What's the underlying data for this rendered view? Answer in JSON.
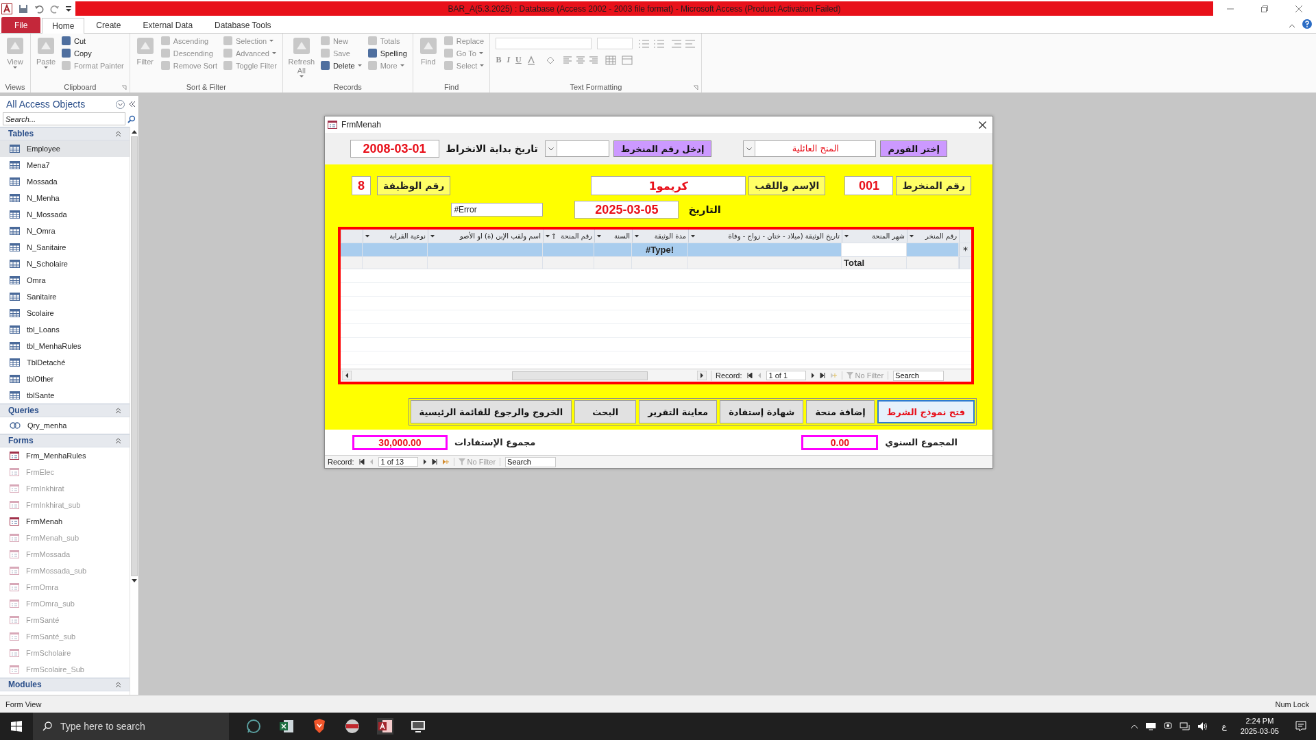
{
  "window": {
    "title": "BAR_A(5.3.2025) : Database (Access 2002 - 2003 file format) - Microsoft Access (Product Activation Failed)"
  },
  "ribbon_tabs": [
    {
      "label": "File",
      "kind": "file",
      "selected": false
    },
    {
      "label": "Home",
      "kind": "tab",
      "selected": true
    },
    {
      "label": "Create",
      "kind": "tab",
      "selected": false
    },
    {
      "label": "External Data",
      "kind": "tab",
      "selected": false
    },
    {
      "label": "Database Tools",
      "kind": "tab",
      "selected": false
    }
  ],
  "ribbon_groups": [
    {
      "label": "Views",
      "items": [
        {
          "label": "View",
          "kind": "large",
          "disabled": true,
          "dropdown": true
        }
      ]
    },
    {
      "label": "Clipboard",
      "launcher": true,
      "items": [
        {
          "label": "Paste",
          "kind": "large",
          "disabled": true,
          "dropdown": true
        },
        {
          "label": "Cut",
          "kind": "small",
          "disabled": false,
          "dropdown": false
        },
        {
          "label": "Copy",
          "kind": "small",
          "disabled": false,
          "dropdown": false
        },
        {
          "label": "Format Painter",
          "kind": "small",
          "disabled": true,
          "dropdown": false
        }
      ]
    },
    {
      "label": "Sort & Filter",
      "launcher": false,
      "items": [
        {
          "label": "Filter",
          "kind": "large",
          "disabled": true,
          "dropdown": false
        },
        {
          "label": "Ascending",
          "kind": "small",
          "disabled": true,
          "dropdown": false
        },
        {
          "label": "Descending",
          "kind": "small",
          "disabled": true,
          "dropdown": false
        },
        {
          "label": "Remove Sort",
          "kind": "small",
          "disabled": true,
          "dropdown": false
        },
        {
          "label": "Selection",
          "kind": "small",
          "disabled": true,
          "dropdown": true
        },
        {
          "label": "Advanced",
          "kind": "small",
          "disabled": true,
          "dropdown": true
        },
        {
          "label": "Toggle Filter",
          "kind": "small",
          "disabled": true,
          "dropdown": false
        }
      ]
    },
    {
      "label": "Records",
      "launcher": false,
      "items": [
        {
          "label": "Refresh All",
          "kind": "large",
          "disabled": true,
          "dropdown": true
        },
        {
          "label": "New",
          "kind": "small",
          "disabled": true,
          "dropdown": false
        },
        {
          "label": "Save",
          "kind": "small",
          "disabled": true,
          "dropdown": false
        },
        {
          "label": "Delete",
          "kind": "small",
          "disabled": false,
          "dropdown": true
        },
        {
          "label": "Totals",
          "kind": "small",
          "disabled": true,
          "dropdown": false
        },
        {
          "label": "Spelling",
          "kind": "small",
          "disabled": false,
          "dropdown": false
        },
        {
          "label": "More",
          "kind": "small",
          "disabled": true,
          "dropdown": true
        }
      ]
    },
    {
      "label": "Find",
      "launcher": false,
      "items": [
        {
          "label": "Find",
          "kind": "large",
          "disabled": true,
          "dropdown": false
        },
        {
          "label": "Replace",
          "kind": "small",
          "disabled": true,
          "dropdown": false
        },
        {
          "label": "Go To",
          "kind": "small",
          "disabled": true,
          "dropdown": true
        },
        {
          "label": "Select",
          "kind": "small",
          "disabled": true,
          "dropdown": true
        }
      ]
    },
    {
      "label": "Text Formatting",
      "launcher": true,
      "items": [
        {
          "label": "B",
          "kind": "format",
          "disabled": true
        },
        {
          "label": "I",
          "kind": "format",
          "disabled": true
        },
        {
          "label": "U",
          "kind": "format",
          "disabled": true
        }
      ]
    }
  ],
  "nav_pane": {
    "title": "All Access Objects",
    "search": {
      "placeholder": "Search..."
    },
    "sections": [
      {
        "title": "Tables",
        "kind": "table",
        "items": [
          {
            "label": "Employee",
            "selected": true,
            "dimmed": false
          },
          {
            "label": "Mena7",
            "selected": false,
            "dimmed": false
          },
          {
            "label": "Mossada",
            "selected": false,
            "dimmed": false
          },
          {
            "label": "N_Menha",
            "selected": false,
            "dimmed": false
          },
          {
            "label": "N_Mossada",
            "selected": false,
            "dimmed": false
          },
          {
            "label": "N_Omra",
            "selected": false,
            "dimmed": false
          },
          {
            "label": "N_Sanitaire",
            "selected": false,
            "dimmed": false
          },
          {
            "label": "N_Scholaire",
            "selected": false,
            "dimmed": false
          },
          {
            "label": "Omra",
            "selected": false,
            "dimmed": false
          },
          {
            "label": "Sanitaire",
            "selected": false,
            "dimmed": false
          },
          {
            "label": "Scolaire",
            "selected": false,
            "dimmed": false
          },
          {
            "label": "tbl_Loans",
            "selected": false,
            "dimmed": false
          },
          {
            "label": "tbl_MenhaRules",
            "selected": false,
            "dimmed": false
          },
          {
            "label": "TblDetaché",
            "selected": false,
            "dimmed": false
          },
          {
            "label": "tblOther",
            "selected": false,
            "dimmed": false
          },
          {
            "label": "tblSante",
            "selected": false,
            "dimmed": false
          }
        ]
      },
      {
        "title": "Queries",
        "kind": "query",
        "items": [
          {
            "label": "Qry_menha",
            "selected": false,
            "dimmed": false
          }
        ]
      },
      {
        "title": "Forms",
        "kind": "form",
        "items": [
          {
            "label": "Frm_MenhaRules",
            "selected": false,
            "dimmed": false
          },
          {
            "label": "FrmElec",
            "selected": false,
            "dimmed": true
          },
          {
            "label": "FrmInkhirat",
            "selected": false,
            "dimmed": true
          },
          {
            "label": "FrmInkhirat_sub",
            "selected": false,
            "dimmed": true
          },
          {
            "label": "FrmMenah",
            "selected": false,
            "dimmed": false
          },
          {
            "label": "FrmMenah_sub",
            "selected": false,
            "dimmed": true
          },
          {
            "label": "FrmMossada",
            "selected": false,
            "dimmed": true
          },
          {
            "label": "FrmMossada_sub",
            "selected": false,
            "dimmed": true
          },
          {
            "label": "FrmOmra",
            "selected": false,
            "dimmed": true
          },
          {
            "label": "FrmOmra_sub",
            "selected": false,
            "dimmed": true
          },
          {
            "label": "FrmSanté",
            "selected": false,
            "dimmed": true
          },
          {
            "label": "FrmSanté_sub",
            "selected": false,
            "dimmed": true
          },
          {
            "label": "FrmScholaire",
            "selected": false,
            "dimmed": true
          },
          {
            "label": "FrmScolaire_Sub",
            "selected": false,
            "dimmed": true
          }
        ]
      },
      {
        "title": "Modules"
      }
    ]
  },
  "form": {
    "title": "FrmMenah",
    "header": {
      "choose_button": "إختر الفورم",
      "form_combo": "المنح العائلية",
      "enter_button": "إدخل رقم المنخرط",
      "start_label": "تاريخ بداية الانخراط",
      "start_date": "2008-03-01"
    },
    "employee_number_label": "رقم المنخرط",
    "employee_number": "001",
    "name_label": "الإسم واللقب",
    "name": "كريمو1",
    "job_label": "رقم الوظيفة",
    "job_number": "8",
    "date_label": "التاريخ",
    "date": "2025-03-05",
    "error_field": "#Error",
    "subform": {
      "columns": [
        {
          "label": "نوعية القرابة",
          "sorted": false
        },
        {
          "label": "اسم ولقب الإبن (ة) او الأصو",
          "sorted": false
        },
        {
          "label": "رقم المنحة",
          "sorted": true
        },
        {
          "label": "السنة",
          "sorted": false
        },
        {
          "label": "مدة الوثيقة",
          "sorted": false
        },
        {
          "label": "تاريخ الوثيقة (ميلاد - ختان - زواج - وفاة",
          "sorted": false
        },
        {
          "label": "شهر المنحة",
          "sorted": false
        },
        {
          "label": "رقم المنخر",
          "sorted": false
        }
      ],
      "rows": [
        {
          "kind": "new",
          "marker": "*",
          "selected": true,
          "cells": [
            "",
            "",
            "",
            "",
            "#Type!",
            "",
            "",
            ""
          ]
        },
        {
          "kind": "total",
          "selected": false,
          "cells": [
            "",
            "",
            "",
            "",
            "",
            "",
            "Total",
            ""
          ]
        }
      ],
      "navigation": {
        "label": "Record:",
        "position": "1 of 1",
        "filter": "No Filter",
        "search": "Search"
      }
    },
    "buttons": [
      {
        "label": "فتح نموذج الشرط",
        "selected": true
      },
      {
        "label": "إضافة منحة",
        "selected": false
      },
      {
        "label": "شهادة إستفادة",
        "selected": false
      },
      {
        "label": "معاينة التقرير",
        "selected": false
      },
      {
        "label": "البحث",
        "selected": false
      },
      {
        "label": "الخروج والرجوع للقائمة الرئيسية",
        "selected": false
      }
    ],
    "yearly_total_label": "المجموع السنوي",
    "yearly_total": "0.00",
    "benefits_total_label": "مجموع الإستفادات",
    "benefits_total": "30,000.00",
    "navigation": {
      "label": "Record:",
      "position": "1 of 13",
      "filter": "No Filter",
      "search": "Search"
    }
  },
  "status_bar": {
    "left": "Form View",
    "right": "Num Lock"
  },
  "taskbar": {
    "search": {
      "placeholder": "Type here to search"
    },
    "language": "ع",
    "time": "2:24 PM",
    "date": "2025-03-05"
  }
}
